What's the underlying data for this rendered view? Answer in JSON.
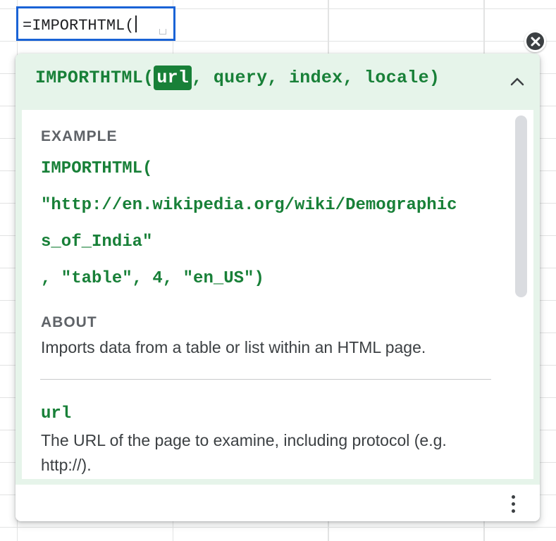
{
  "cell": {
    "formula": "=IMPORTHTML("
  },
  "help": {
    "signature": {
      "fn": "IMPORTHTML(",
      "active_param": "url",
      "rest": ", query, index, locale)"
    },
    "example": {
      "heading": "EXAMPLE",
      "lines": [
        "IMPORTHTML(",
        "\"http://en.wikipedia.org/wiki/Demographic",
        "s_of_India\"",
        ", \"table\", 4, \"en_US\")"
      ]
    },
    "about": {
      "heading": "ABOUT",
      "text": "Imports data from a table or list within an HTML page."
    },
    "param": {
      "name": "url",
      "desc": "The URL of the page to examine, including protocol (e.g. http://)."
    },
    "icons": {
      "close": "close-icon",
      "collapse": "chevron-up-icon",
      "more": "more-vert-icon"
    }
  },
  "colors": {
    "accent_green": "#188038",
    "header_bg": "#e6f4ea",
    "selection_blue": "#1a63d6"
  }
}
